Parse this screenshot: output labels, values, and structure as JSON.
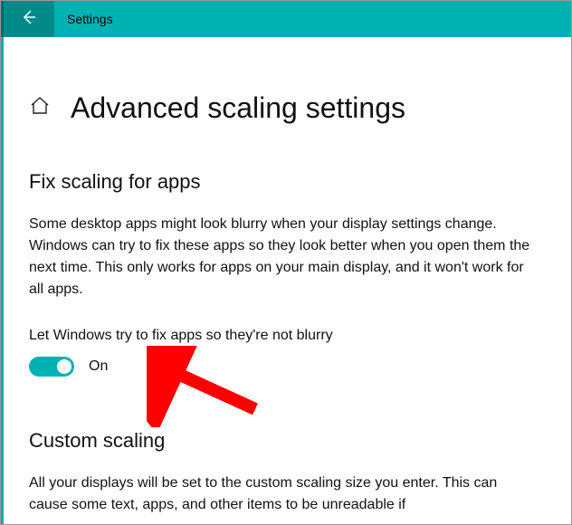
{
  "titlebar": {
    "app_title": "Settings"
  },
  "page": {
    "title": "Advanced scaling settings"
  },
  "section1": {
    "heading": "Fix scaling for apps",
    "description": "Some desktop apps might look blurry when your display settings change. Windows can try to fix these apps so they look better when you open them the next time. This only works for apps on your main display, and it won't work for all apps.",
    "toggle_label": "Let Windows try to fix apps so they're not blurry",
    "toggle_state": "On"
  },
  "section2": {
    "heading": "Custom scaling",
    "description": "All your displays will be set to the custom scaling size you enter. This can cause some text, apps, and other items to be unreadable if"
  },
  "colors": {
    "accent": "#00b2b2",
    "annotation": "#ff0000"
  }
}
